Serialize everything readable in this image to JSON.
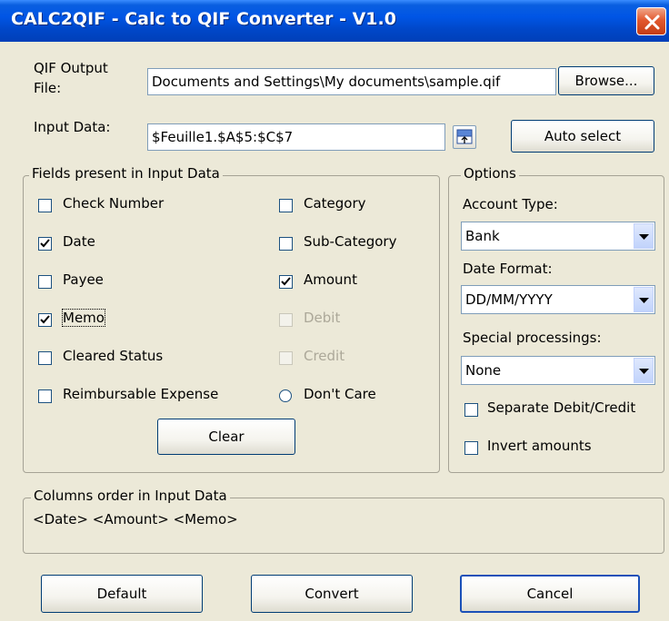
{
  "window": {
    "title": "CALC2QIF - Calc to QIF Converter - V1.0"
  },
  "output": {
    "label": "QIF Output\nFile:",
    "label_line1": "QIF Output",
    "label_line2": "File:",
    "value": "Documents and Settings\\My documents\\sample.qif",
    "browse_label": "Browse..."
  },
  "input": {
    "label": "Input Data:",
    "value": "$Feuille1.$A$5:$C$7",
    "auto_select_label": "Auto select"
  },
  "fields_group": {
    "title": "Fields present in Input Data",
    "left": [
      {
        "label": "Check Number",
        "checked": false,
        "enabled": true
      },
      {
        "label": "Date",
        "checked": true,
        "enabled": true
      },
      {
        "label": "Payee",
        "checked": false,
        "enabled": true
      },
      {
        "label": "Memo",
        "checked": true,
        "enabled": true
      },
      {
        "label": "Cleared Status",
        "checked": false,
        "enabled": true
      },
      {
        "label": "Reimbursable Expense",
        "checked": false,
        "enabled": true
      }
    ],
    "right": [
      {
        "label": "Category",
        "checked": false,
        "enabled": true
      },
      {
        "label": "Sub-Category",
        "checked": false,
        "enabled": true
      },
      {
        "label": "Amount",
        "checked": true,
        "enabled": true
      },
      {
        "label": "Debit",
        "checked": false,
        "enabled": false
      },
      {
        "label": "Credit",
        "checked": false,
        "enabled": false
      }
    ],
    "dont_care_label": "Don't Care",
    "clear_label": "Clear"
  },
  "options": {
    "title": "Options",
    "account_type_label": "Account Type:",
    "account_type_value": "Bank",
    "date_format_label": "Date Format:",
    "date_format_value": "DD/MM/YYYY",
    "special_label": "Special processings:",
    "special_value": "None",
    "separate_label": "Separate Debit/Credit",
    "invert_label": "Invert amounts"
  },
  "columns": {
    "title": "Columns order in Input Data",
    "value": "<Date> <Amount> <Memo>"
  },
  "buttons": {
    "default_label": "Default",
    "convert_label": "Convert",
    "cancel_label": "Cancel"
  },
  "colors": {
    "titlebar": "#0055e5",
    "dialog_bg": "#ece9d8",
    "close": "#e2592f"
  }
}
